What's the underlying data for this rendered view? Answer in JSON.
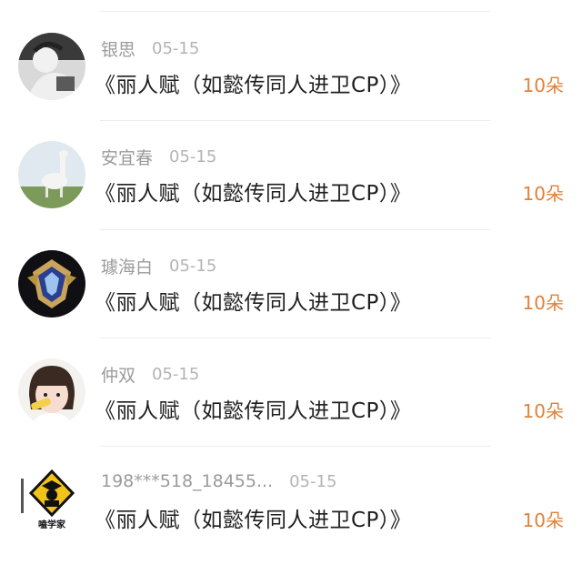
{
  "records": [
    {
      "name": "银思",
      "time": "05-15",
      "title": "《丽人赋（如懿传同人进卫CP）》",
      "gift": "10朵",
      "avatar": "bw-photo"
    },
    {
      "name": "安宜春",
      "time": "05-15",
      "title": "《丽人赋（如懿传同人进卫CP）》",
      "gift": "10朵",
      "avatar": "alpaca"
    },
    {
      "name": "璩海白",
      "time": "05-15",
      "title": "《丽人赋（如懿传同人进卫CP）》",
      "gift": "10朵",
      "avatar": "game-emblem"
    },
    {
      "name": "仲双",
      "time": "05-15",
      "title": "《丽人赋（如懿传同人进卫CP）》",
      "gift": "10朵",
      "avatar": "child"
    },
    {
      "name": "198***518_18455...",
      "time": "05-15",
      "title": "《丽人赋（如懿传同人进卫CP）》",
      "gift": "10朵",
      "avatar": "scholar-logo"
    }
  ],
  "logo_text": "嗑学家"
}
